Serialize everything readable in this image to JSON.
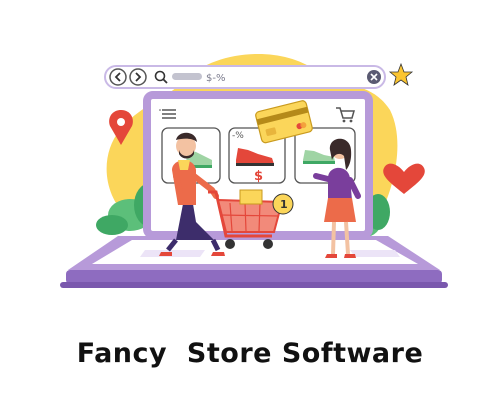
{
  "browser": {
    "address_text": "$-%",
    "back_icon": "chevron-left-icon",
    "forward_icon": "chevron-right-icon",
    "search_icon": "search-icon",
    "close_icon": "close-icon",
    "favorite_icon": "star-icon"
  },
  "store": {
    "menu_icon": "hamburger-menu-icon",
    "cart_icon": "shopping-cart-icon",
    "discount_label": "-%",
    "price_label": "$",
    "cart_badge": "1"
  },
  "footer": {
    "title": "Fancy  Store Software"
  },
  "colors": {
    "laptop": "#b79ad9",
    "laptop_dark": "#8e6cc0",
    "blob": "#fbd65a",
    "accent_red": "#e4473a",
    "leaf_green": "#5cbf7a"
  }
}
